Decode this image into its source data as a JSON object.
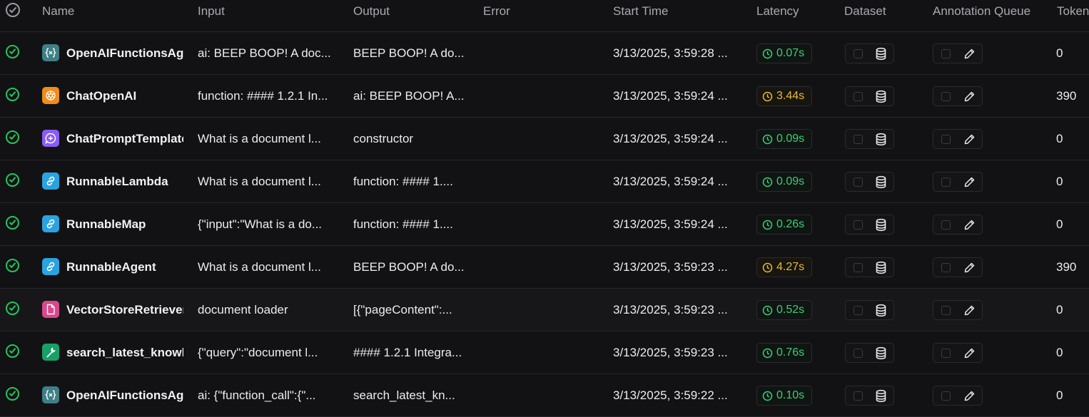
{
  "headers": {
    "name": "Name",
    "input": "Input",
    "output": "Output",
    "error": "Error",
    "start_time": "Start Time",
    "latency": "Latency",
    "dataset": "Dataset",
    "annotation_queue": "Annotation Queue",
    "tokens": "Tokens"
  },
  "rows": [
    {
      "name": "OpenAIFunctionsAgent",
      "input": "ai: BEEP BOOP! A doc...",
      "output": "BEEP BOOP! A do...",
      "error": "",
      "start_time": "3/13/2025, 3:59:28 ...",
      "latency": "0.07s",
      "latency_status": "fast",
      "tokens": "0",
      "run_type": "chain",
      "run_type_icon": "braces-icon",
      "icon_color": "#3f7f86"
    },
    {
      "name": "ChatOpenAI",
      "input": "function: #### 1.2.1 In...",
      "output": "ai: BEEP BOOP! A...",
      "error": "",
      "start_time": "3/13/2025, 3:59:24 ...",
      "latency": "3.44s",
      "latency_status": "slow",
      "tokens": "390",
      "run_type": "llm",
      "run_type_icon": "openai-icon",
      "icon_color": "#f08c1a"
    },
    {
      "name": "ChatPromptTemplate",
      "input": "What is a document l...",
      "output": "constructor",
      "error": "",
      "start_time": "3/13/2025, 3:59:24 ...",
      "latency": "0.09s",
      "latency_status": "fast",
      "tokens": "0",
      "run_type": "prompt",
      "run_type_icon": "chat-plus-icon",
      "icon_color": "#8b5cf6"
    },
    {
      "name": "RunnableLambda",
      "input": "What is a document l...",
      "output": "function: #### 1....",
      "error": "",
      "start_time": "3/13/2025, 3:59:24 ...",
      "latency": "0.09s",
      "latency_status": "fast",
      "tokens": "0",
      "run_type": "runnable",
      "run_type_icon": "link-icon",
      "icon_color": "#2aa3e0"
    },
    {
      "name": "RunnableMap",
      "input": "{\"input\":\"What is a do...",
      "output": "function: #### 1....",
      "error": "",
      "start_time": "3/13/2025, 3:59:24 ...",
      "latency": "0.26s",
      "latency_status": "fast",
      "tokens": "0",
      "run_type": "runnable",
      "run_type_icon": "link-icon",
      "icon_color": "#2aa3e0"
    },
    {
      "name": "RunnableAgent",
      "input": "What is a document l...",
      "output": "BEEP BOOP! A do...",
      "error": "",
      "start_time": "3/13/2025, 3:59:23 ...",
      "latency": "4.27s",
      "latency_status": "slow",
      "tokens": "390",
      "run_type": "runnable",
      "run_type_icon": "link-icon",
      "icon_color": "#2aa3e0"
    },
    {
      "name": "VectorStoreRetriever",
      "input": "document loader",
      "output": "[{\"pageContent\":...",
      "error": "",
      "start_time": "3/13/2025, 3:59:23 ...",
      "latency": "0.52s",
      "latency_status": "fast",
      "tokens": "0",
      "run_type": "retriever",
      "run_type_icon": "document-icon",
      "icon_color": "#d9488b"
    },
    {
      "name": "search_latest_knowledge",
      "input": "{\"query\":\"document l...",
      "output": "#### 1.2.1 Integra...",
      "error": "",
      "start_time": "3/13/2025, 3:59:23 ...",
      "latency": "0.76s",
      "latency_status": "fast",
      "tokens": "0",
      "run_type": "tool",
      "run_type_icon": "wrench-icon",
      "icon_color": "#16a06a"
    },
    {
      "name": "OpenAIFunctionsAgent",
      "input": "ai: {\"function_call\":{\"...",
      "output": "search_latest_kn...",
      "error": "",
      "start_time": "3/13/2025, 3:59:22 ...",
      "latency": "0.10s",
      "latency_status": "fast",
      "tokens": "0",
      "run_type": "chain",
      "run_type_icon": "braces-icon",
      "icon_color": "#3f7f86"
    }
  ],
  "colors": {
    "success": "#22c55e",
    "latency_fast": "#3ccf74",
    "latency_slow": "#e6b93a",
    "background": "#121214",
    "header_text": "#a9a9b0"
  }
}
